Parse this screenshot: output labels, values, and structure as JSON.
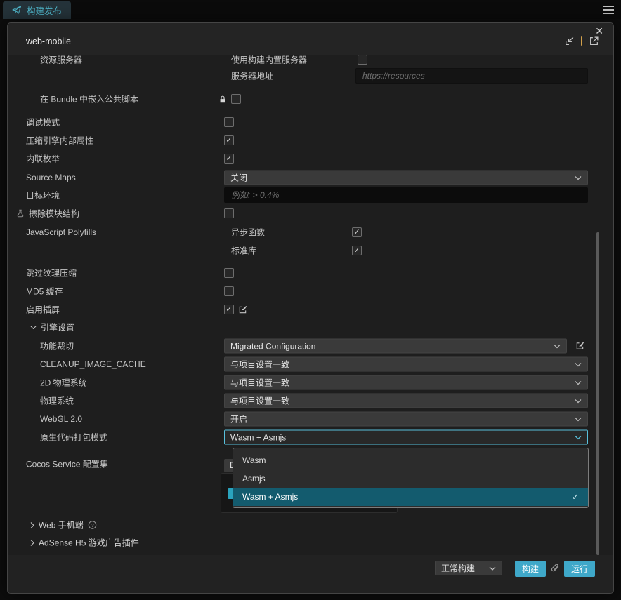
{
  "titlebar": {
    "tab_label": "构建发布"
  },
  "dialog": {
    "title": "web-mobile"
  },
  "form": {
    "resource_server_label": "资源服务器",
    "use_builtin_server_label": "使用构建内置服务器",
    "server_address_label": "服务器地址",
    "server_address_placeholder": "https://resources",
    "embed_common_scripts_label": "在 Bundle 中嵌入公共脚本",
    "debug_mode_label": "调试模式",
    "compress_engine_props_label": "压缩引擎内部属性",
    "inline_enums_label": "内联枚举",
    "source_maps_label": "Source Maps",
    "source_maps_value": "关闭",
    "target_env_label": "目标环境",
    "target_env_placeholder": "例如: > 0.4%",
    "erase_module_structure_label": "擦除模块结构",
    "js_polyfills_label": "JavaScript Polyfills",
    "async_functions_label": "异步函数",
    "std_lib_label": "标准库",
    "skip_texture_compression_label": "跳过纹理压缩",
    "md5_cache_label": "MD5 缓存",
    "enable_splash_label": "启用插屏",
    "engine_settings_label": "引擎设置",
    "feature_crop_label": "功能裁切",
    "feature_crop_value": "Migrated Configuration",
    "cleanup_image_cache_label": "CLEANUP_IMAGE_CACHE",
    "physics_2d_label": "2D 物理系统",
    "physics_label": "物理系统",
    "project_match_value": "与项目设置一致",
    "webgl2_label": "WebGL 2.0",
    "webgl2_value": "开启",
    "native_code_mode_label": "原生代码打包模式",
    "native_code_mode_value": "Wasm + Asmjs",
    "cocos_service_label": "Cocos Service 配置集",
    "cocos_service_button_visible_text": "D",
    "web_mobile_section_label": "Web 手机端",
    "adsense_section_label": "AdSense H5 游戏广告插件"
  },
  "checkboxes": {
    "use_builtin_server": false,
    "embed_common_scripts": false,
    "debug_mode": false,
    "compress_engine_props": true,
    "inline_enums": true,
    "erase_module_structure": false,
    "async_functions": true,
    "std_lib": true,
    "skip_texture_compression": false,
    "md5_cache": false,
    "enable_splash": true
  },
  "dropdown_menu": {
    "options": [
      "Wasm",
      "Asmjs",
      "Wasm + Asmjs"
    ],
    "selected": "Wasm + Asmjs"
  },
  "footer": {
    "build_mode_value": "正常构建",
    "build_label": "构建",
    "run_label": "运行"
  },
  "icons": {
    "check_glyph": "✓",
    "close_glyph": "✕",
    "help_glyph": "?"
  },
  "colors": {
    "accent_button": "#3fa8c9",
    "tab_text": "#4fb5c9",
    "focus_border": "#58c0dc",
    "menu_selected_bg": "#135b6e",
    "header_divider": "#d2a04a"
  }
}
